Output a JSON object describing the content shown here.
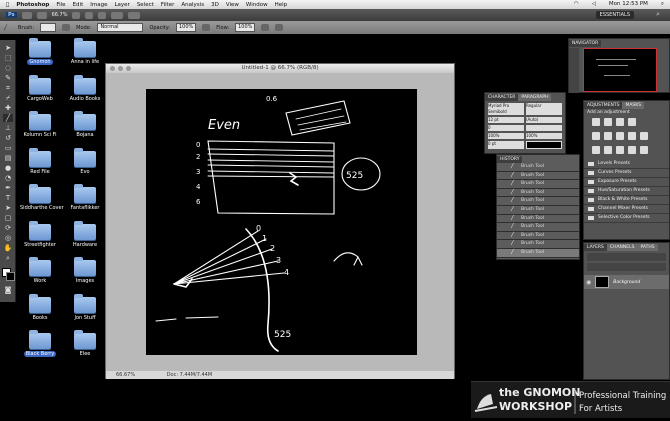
{
  "menubar": {
    "app": "Photoshop",
    "items": [
      "File",
      "Edit",
      "Image",
      "Layer",
      "Select",
      "Filter",
      "Analysis",
      "3D",
      "View",
      "Window",
      "Help"
    ],
    "clock": "Mon 12:53 PM"
  },
  "appbar": {
    "zoom": "66.7%",
    "workspace": "ESSENTIALS"
  },
  "options": {
    "brush_label": "Brush:",
    "mode_label": "Mode:",
    "mode_value": "Normal",
    "opacity_label": "Opacity:",
    "opacity_value": "100%",
    "flow_label": "Flow:",
    "flow_value": "100%"
  },
  "desktop_icons": [
    {
      "label": "Gnomon",
      "selected": true
    },
    {
      "label": "Anna in life",
      "selected": false
    },
    {
      "label": "CargoWeb",
      "selected": false
    },
    {
      "label": "Audio Books",
      "selected": false
    },
    {
      "label": "Kolumn Sci Fi",
      "selected": false
    },
    {
      "label": "Bojana",
      "selected": false
    },
    {
      "label": "Red File",
      "selected": false
    },
    {
      "label": "Evo",
      "selected": false
    },
    {
      "label": "Siddharthe Cover",
      "selected": false
    },
    {
      "label": "Fantaflikker",
      "selected": false
    },
    {
      "label": "Streetfighter",
      "selected": false
    },
    {
      "label": "Hardware",
      "selected": false
    },
    {
      "label": "Work",
      "selected": false
    },
    {
      "label": "Images",
      "selected": false
    },
    {
      "label": "Books",
      "selected": false
    },
    {
      "label": "Jon Stuff",
      "selected": false
    },
    {
      "label": "Black Berry",
      "selected": true
    },
    {
      "label": "Elee",
      "selected": false
    }
  ],
  "document": {
    "title": "Untitled-1 @ 66.7% (RGB/8)",
    "status_zoom": "66.67%",
    "status_doc": "Doc: 7.44M/7.44M",
    "sketch": {
      "word": "Even",
      "number_a": "525",
      "number_b": "525",
      "fan_labels": [
        "0",
        "1",
        "2",
        "3",
        "4"
      ],
      "row_marks": [
        "0",
        "1",
        "2",
        "3",
        "4",
        "5",
        "6"
      ],
      "small_label": "0.6"
    }
  },
  "panels": {
    "navigator_tab": "NAVIGATOR",
    "character_tabs": [
      "CHARACTER",
      "PARAGRAPH"
    ],
    "character": {
      "font": "Myriad Pro Semibold",
      "style": "Regular",
      "size": "12 pt",
      "leading": "(Auto)",
      "tracking": "0",
      "scale_v": "100%",
      "scale_h": "100%",
      "baseline": "0 pt"
    },
    "history_tab": "HISTORY",
    "history_items": [
      "Brush Tool",
      "Brush Tool",
      "Brush Tool",
      "Brush Tool",
      "Brush Tool",
      "Brush Tool",
      "Brush Tool",
      "Brush Tool",
      "Brush Tool",
      "Brush Tool",
      "Brush Tool"
    ],
    "adjust_tabs": [
      "ADJUSTMENTS",
      "MASKS"
    ],
    "adjust_title": "Add an adjustment",
    "presets": [
      "Levels Presets",
      "Curves Presets",
      "Exposure Presets",
      "Hue/Saturation Presets",
      "Black & White Presets",
      "Channel Mixer Presets",
      "Selective Color Presets"
    ],
    "layers_tabs": [
      "LAYERS",
      "CHANNELS",
      "PATHS"
    ],
    "layer_name": "Background"
  },
  "watermark": {
    "brand_top": "the GNOMON",
    "brand_bottom": "WORKSHOP",
    "tagline_1": "Professional Training",
    "tagline_2": "For Artists"
  }
}
